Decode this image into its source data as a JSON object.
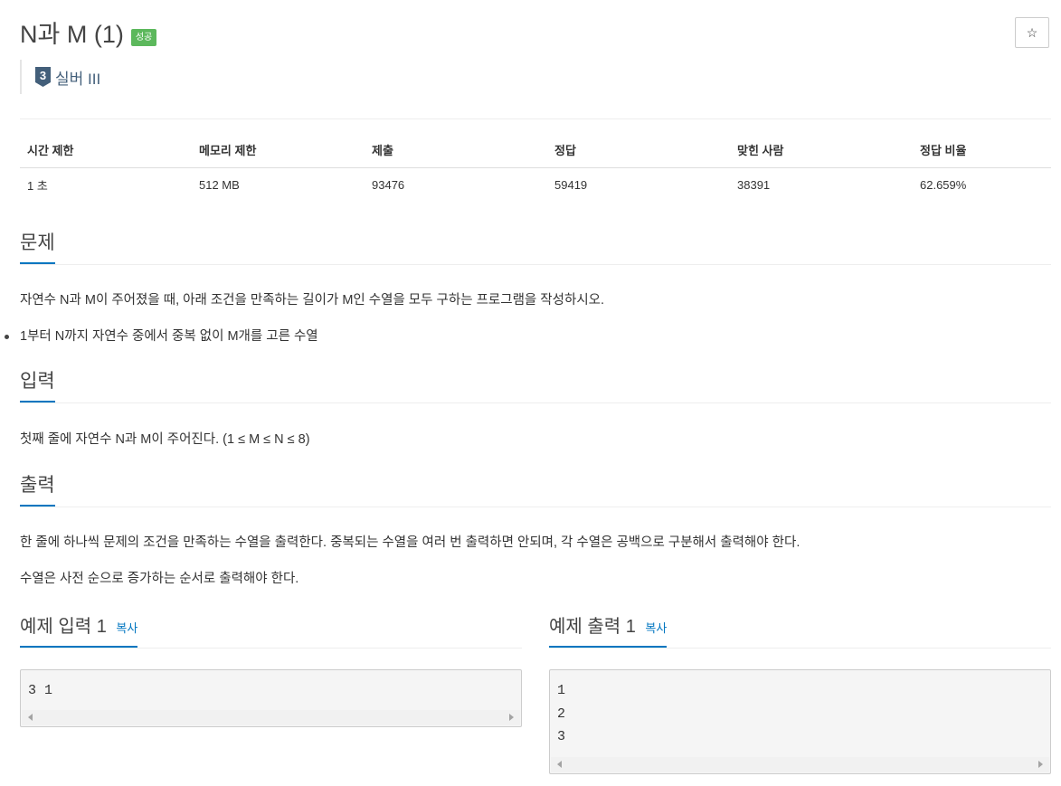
{
  "problem": {
    "title": "N과 M (1)",
    "status_badge": "성공",
    "star_icon": "☆"
  },
  "tier": {
    "number": "3",
    "label": "실버 III",
    "color": "#435f7a"
  },
  "info_table": {
    "headers": [
      "시간 제한",
      "메모리 제한",
      "제출",
      "정답",
      "맞힌 사람",
      "정답 비율"
    ],
    "values": [
      "1 초",
      "512 MB",
      "93476",
      "59419",
      "38391",
      "62.659%"
    ]
  },
  "sections": {
    "description": {
      "heading": "문제",
      "paragraph": "자연수 N과 M이 주어졌을 때, 아래 조건을 만족하는 길이가 M인 수열을 모두 구하는 프로그램을 작성하시오.",
      "bullet": "1부터 N까지 자연수 중에서 중복 없이 M개를 고른 수열"
    },
    "input": {
      "heading": "입력",
      "paragraph": "첫째 줄에 자연수 N과 M이 주어진다. (1 ≤ M ≤ N ≤ 8)"
    },
    "output": {
      "heading": "출력",
      "paragraph1": "한 줄에 하나씩 문제의 조건을 만족하는 수열을 출력한다. 중복되는 수열을 여러 번 출력하면 안되며, 각 수열은 공백으로 구분해서 출력해야 한다.",
      "paragraph2": "수열은 사전 순으로 증가하는 순서로 출력해야 한다."
    }
  },
  "samples": {
    "input": {
      "heading": "예제 입력 1",
      "copy_label": "복사",
      "content": "3 1"
    },
    "output": {
      "heading": "예제 출력 1",
      "copy_label": "복사",
      "content": "1\n2\n3"
    }
  },
  "colors": {
    "accent": "#0076c0",
    "success": "#5cb85c"
  }
}
